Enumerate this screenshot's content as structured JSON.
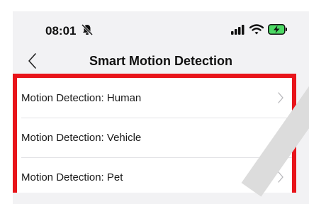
{
  "status_bar": {
    "time": "08:01",
    "icons": [
      "bell-slash-icon",
      "signal-bars-icon",
      "wifi-icon",
      "battery-charging-icon"
    ]
  },
  "nav": {
    "title": "Smart Motion Detection",
    "back_icon": "chevron-left-icon"
  },
  "settings": {
    "items": [
      {
        "label": "Motion Detection: Human"
      },
      {
        "label": "Motion Detection: Vehicle"
      },
      {
        "label": "Motion Detection: Pet"
      }
    ]
  },
  "colors": {
    "highlight_border": "#e8141a",
    "background": "#f2f2f4",
    "battery": "#4cd964"
  }
}
